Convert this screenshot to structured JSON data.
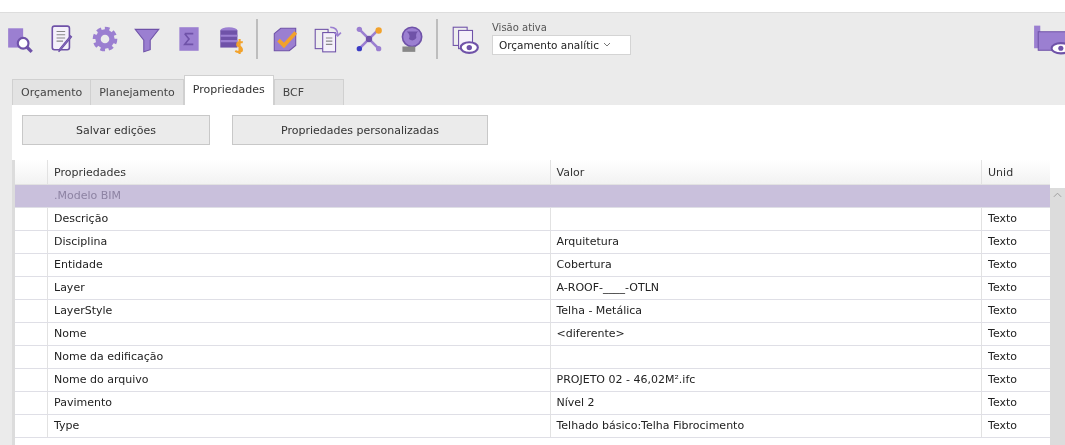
{
  "toolbar": {
    "view_label": "Visão ativa",
    "view_select": {
      "value": "Orçamento analític"
    }
  },
  "tabs": [
    {
      "label": "Orçamento",
      "selected": false
    },
    {
      "label": "Planejamento",
      "selected": false
    },
    {
      "label": "Propriedades",
      "selected": true
    },
    {
      "label": "BCF",
      "selected": false
    }
  ],
  "buttons": [
    "Salvar edições",
    "Propriedades personalizadas"
  ],
  "table": {
    "columns": [
      "Propriedades",
      "Valor",
      "Unid"
    ],
    "rows": [
      {
        "kind": "group",
        "property": ".Modelo BIM"
      },
      {
        "kind": "property",
        "property": "Descrição",
        "unit": "Texto"
      },
      {
        "kind": "property",
        "property": "Disciplina",
        "value": "Arquitetura",
        "unit": "Texto"
      },
      {
        "kind": "property",
        "property": "Entidade",
        "value": "Cobertura",
        "unit": "Texto"
      },
      {
        "kind": "property",
        "property": "Layer",
        "value": "A-ROOF-____-OTLN",
        "unit": "Texto"
      },
      {
        "kind": "property",
        "property": "LayerStyle",
        "value": "Telha - Metálica",
        "unit": "Texto"
      },
      {
        "kind": "property",
        "property": "Nome",
        "value": "<diferente>",
        "unit": "Texto"
      },
      {
        "kind": "property",
        "property": "Nome da edificação",
        "unit": "Texto"
      },
      {
        "kind": "property",
        "property": "Nome do arquivo",
        "value": "PROJETO 02 - 46,02M².ifc",
        "unit": "Texto"
      },
      {
        "kind": "property",
        "property": "Pavimento",
        "value": "Nível 2",
        "unit": "Texto"
      },
      {
        "kind": "property",
        "property": "Type",
        "value": "Telhado básico:Telha Fibrocimento",
        "unit": "Texto"
      }
    ]
  }
}
